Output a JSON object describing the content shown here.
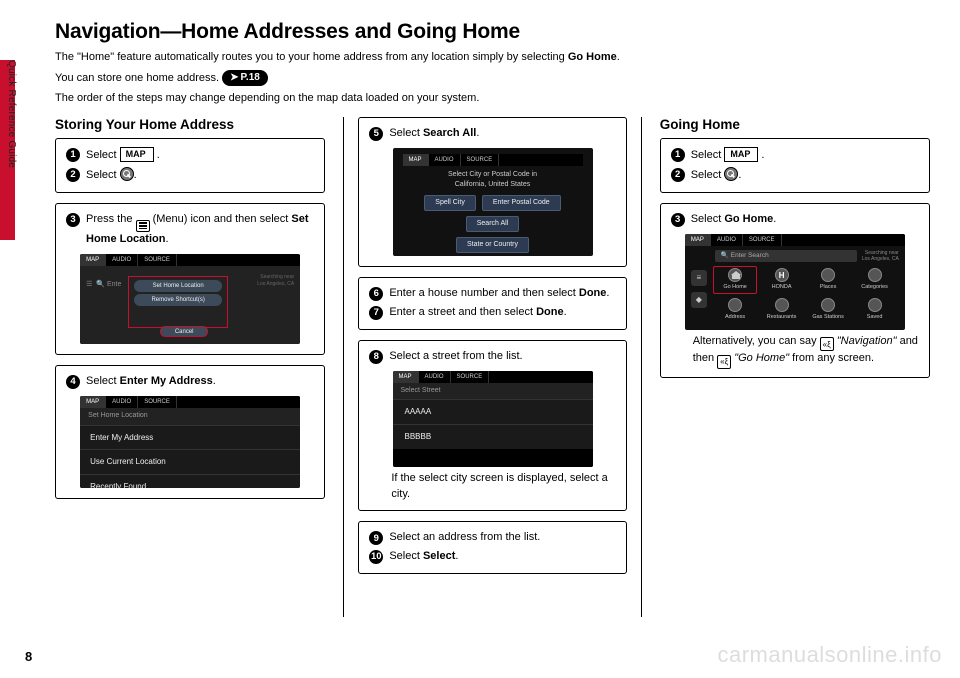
{
  "side_tab_label": "Quick Reference Guide",
  "page_number": "8",
  "watermark": "carmanualsonline.info",
  "title": "Navigation—Home Addresses and Going Home",
  "intro1_a": "The \"Home\" feature automatically routes you to your home address from any location simply by selecting ",
  "intro1_b": "Go Home",
  "intro1_c": ".",
  "intro2_a": "You can store one home address. ",
  "pref": "P.18",
  "intro3": "The order of the steps may change depending on the map data loaded on your system.",
  "storing_heading": "Storing Your Home Address",
  "going_heading": "Going Home",
  "map_label": "MAP",
  "steps": {
    "s1": "Select ",
    "s2a": "Select ",
    "s2b": ".",
    "s3a": "Press the ",
    "s3b": " (Menu) icon and then select ",
    "s3c": "Set Home Location",
    "s4a": "Select ",
    "s4b": "Enter My Address",
    "s5a": "Select ",
    "s5b": "Search All",
    "s6a": "Enter a house number and then select ",
    "s6b": "Done",
    "s7a": "Enter a street and then select ",
    "s7b": "Done",
    "s8": "Select a street from the list.",
    "s8_note": "If the select city screen is displayed, select a city.",
    "s9": "Select an address from the list.",
    "s10a": "Select ",
    "s10b": "Select",
    "g3a": "Select ",
    "g3b": "Go Home",
    "alt_a": "Alternatively, you can say ",
    "alt_b": "\"Navigation\"",
    "alt_c": " and then ",
    "alt_d": "\"Go Home\"",
    "alt_e": " from any screen."
  },
  "mock": {
    "tabs": {
      "map": "MAP",
      "audio": "AUDIO",
      "source": "SOURCE"
    },
    "m1": {
      "set_home": "Set Home Location",
      "remove": "Remove Shortcut(s)",
      "cancel": "Cancel",
      "enter": "Ente",
      "right": "Searching near\nLos Angeles, CA"
    },
    "m2": {
      "hdr": "Set Home Location",
      "r1": "Enter My Address",
      "r2": "Use Current Location",
      "r3": "Recently Found"
    },
    "m3": {
      "hint": "Select City or Postal Code in\nCalifornia, United States",
      "spell": "Spell City",
      "postal": "Enter Postal Code",
      "search": "Search All",
      "state": "State or Country"
    },
    "m4": {
      "hdr": "Select Street",
      "r1": "AAAAA",
      "r2": "BBBBB"
    },
    "m5": {
      "search": "Enter Search",
      "right": "Searching near\nLos Angeles, CA",
      "cells": [
        "Go Home",
        "HONDA",
        "Places",
        "Categories",
        "Address",
        "Restaurants",
        "Gas Stations",
        "Saved"
      ]
    }
  }
}
